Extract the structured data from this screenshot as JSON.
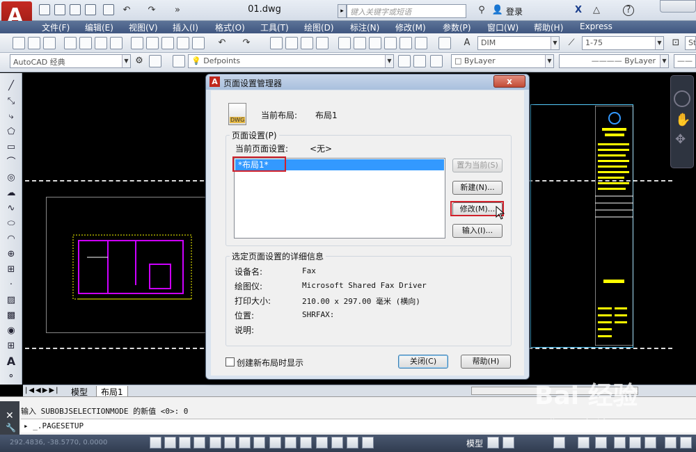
{
  "titlebar": {
    "doc_title": "01.dwg",
    "search_placeholder": "键入关键字或短语",
    "login_label": "登录"
  },
  "menubar": {
    "items": [
      "文件(F)",
      "编辑(E)",
      "视图(V)",
      "插入(I)",
      "格式(O)",
      "工具(T)",
      "绘图(D)",
      "标注(N)",
      "修改(M)",
      "参数(P)",
      "窗口(W)",
      "帮助(H)",
      "Express"
    ]
  },
  "toolbar1": {
    "dimstyle": "DIM",
    "tablestyle": "1-75",
    "extra": "St"
  },
  "toolbar2": {
    "workspace": "AutoCAD 经典",
    "layer": "Defpoints",
    "color": "ByLayer",
    "linetype": "ByLayer"
  },
  "layout_tabs": {
    "model": "模型",
    "layout1": "布局1"
  },
  "command": {
    "history_line": "输入 SUBOBJSELECTIONMODE 的新值 <0>: 0",
    "prompt_symbol": "▸",
    "input_line": "_.PAGESETUP"
  },
  "statusbar": {
    "coords": "292.4836, -38.5770, 0.0000",
    "model_label": "模型"
  },
  "dialog": {
    "title": "页面设置管理器",
    "close_symbol": "x",
    "current_layout_label": "当前布局:",
    "current_layout_value": "布局1",
    "page_setups_group": "页面设置(P)",
    "current_page_setup_label": "当前页面设置:",
    "current_page_setup_value": "<无>",
    "list_items": [
      "*布局1*"
    ],
    "set_current_button": "置为当前(S)",
    "new_button": "新建(N)...",
    "modify_button": "修改(M)...",
    "import_button": "输入(I)...",
    "details_group": "选定页面设置的详细信息",
    "details": [
      {
        "label": "设备名:",
        "value": "Fax"
      },
      {
        "label": "绘图仪:",
        "value": "Microsoft Shared Fax Driver"
      },
      {
        "label": "打印大小:",
        "value": "210.00 x 297.00 毫米 (横向)"
      },
      {
        "label": "位置:",
        "value": "SHRFAX:"
      },
      {
        "label": "说明:",
        "value": ""
      }
    ],
    "checkbox_label": "创建新布局时显示",
    "ok_close_button": "关闭(C)",
    "help_button": "帮助(H)"
  },
  "watermark": {
    "text": "Bai 经验",
    "url": "jingyan.baidu.com"
  },
  "colors": {
    "menubar": "#4a6189",
    "dialog_bg": "#f0f0f0",
    "highlight_red": "#d0202a",
    "selection_blue": "#3399ff",
    "canvas": "#000000"
  }
}
